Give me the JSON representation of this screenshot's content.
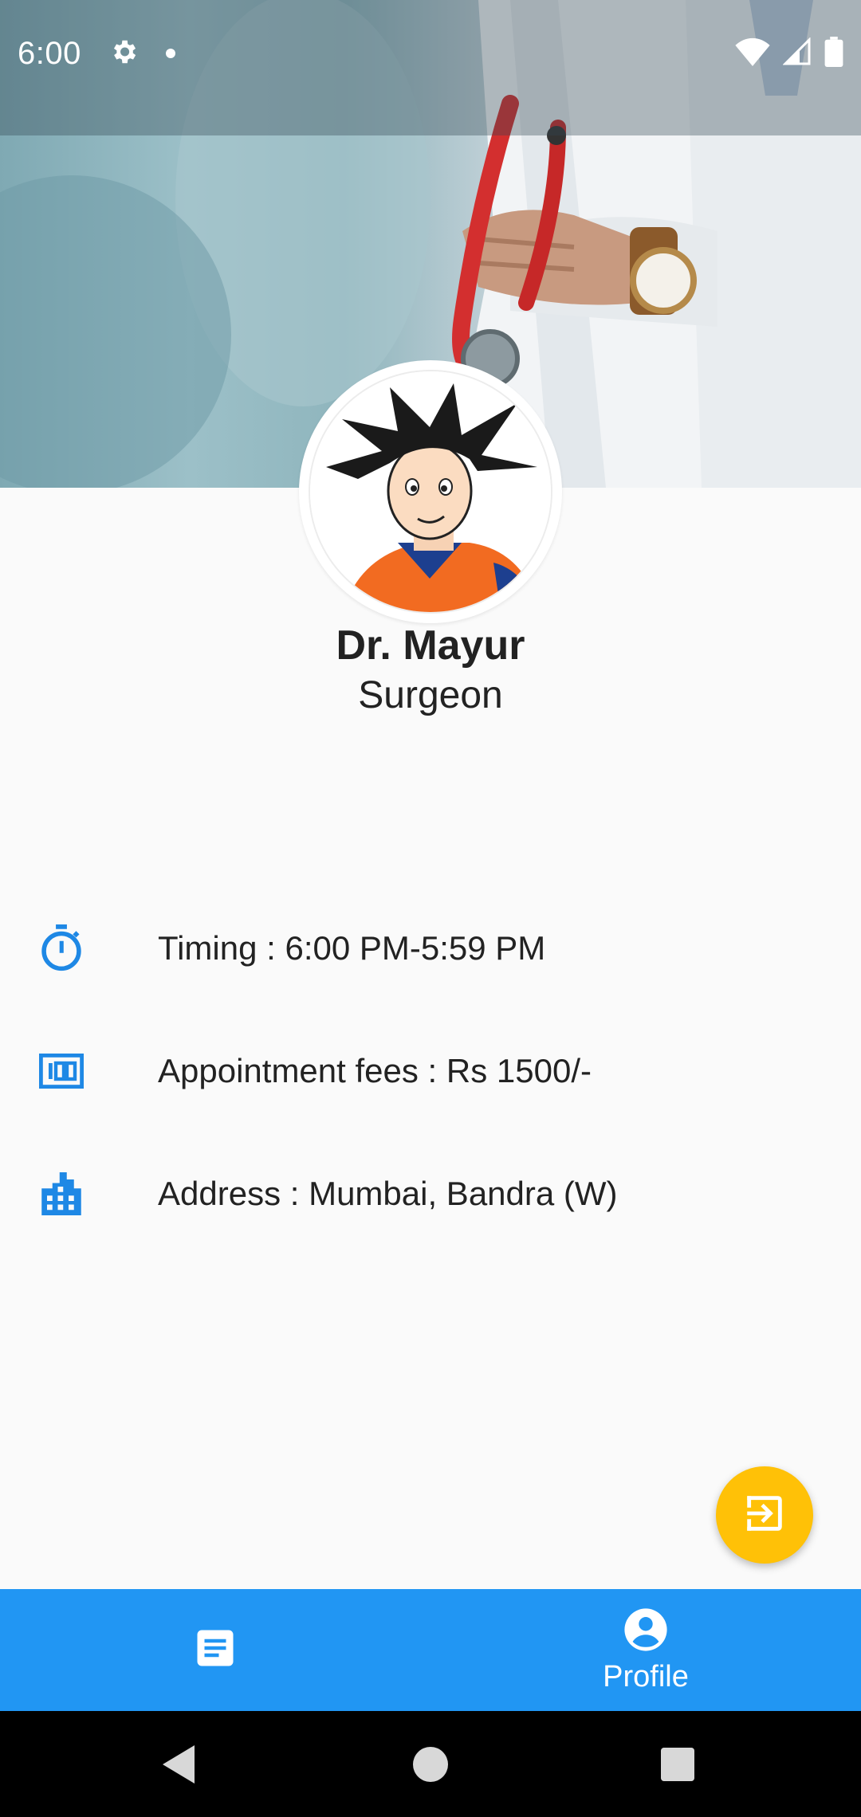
{
  "status_bar": {
    "time": "6:00",
    "icons": [
      "gear-icon",
      "notification-dot-icon",
      "wifi-icon",
      "cell-signal-icon",
      "battery-icon"
    ]
  },
  "profile": {
    "name": "Dr. Mayur",
    "title": "Surgeon"
  },
  "info": {
    "timing": {
      "icon": "timer-icon",
      "text": "Timing : 6:00 PM-5:59 PM"
    },
    "fees": {
      "icon": "money-icon",
      "text": "Appointment fees : Rs 1500/-"
    },
    "address": {
      "icon": "building-icon",
      "text": "Address : Mumbai, Bandra (W)"
    }
  },
  "fab": {
    "icon": "logout-icon"
  },
  "bottom_nav": {
    "items": [
      {
        "icon": "article-icon",
        "label": ""
      },
      {
        "icon": "account-circle-icon",
        "label": "Profile"
      }
    ]
  },
  "system_nav": [
    "back-icon",
    "home-icon",
    "recents-icon"
  ],
  "colors": {
    "primary": "#2196f3",
    "accent": "#ffc107",
    "icon_blue": "#1e88e5",
    "text": "#222222",
    "background": "#fafafa"
  }
}
